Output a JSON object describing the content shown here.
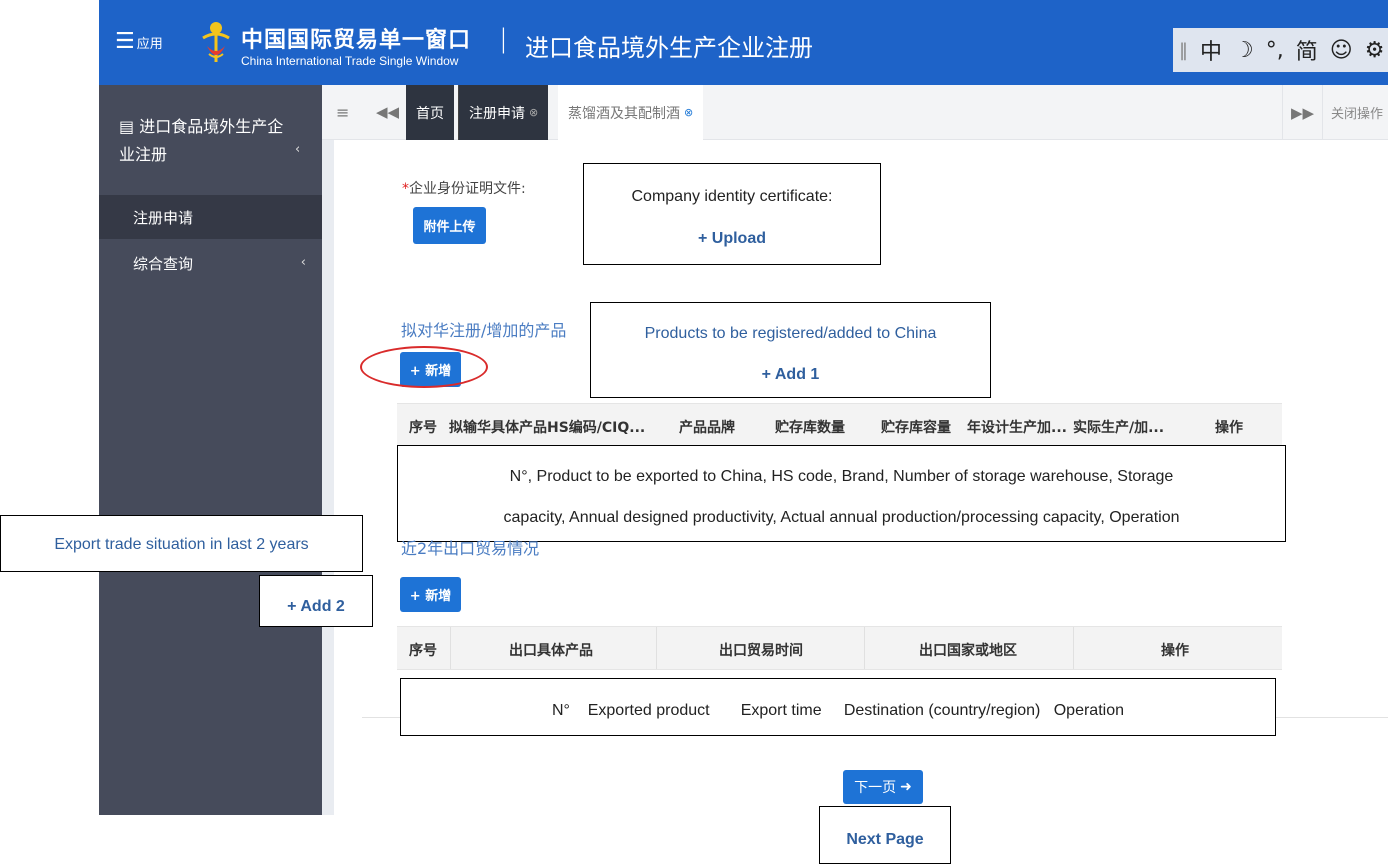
{
  "header": {
    "app_label": "应用",
    "brand_cn": "中国国际贸易单一窗口",
    "brand_en": "China International Trade Single Window",
    "separator": "|",
    "system_title": "进口食品境外生产企业注册",
    "ime": {
      "grip": "‖",
      "lang": "中",
      "moon": "☽",
      "punct": "°,",
      "simplified": "简",
      "emoji": "☺",
      "settings": "⚙"
    }
  },
  "sidebar": {
    "title": "进口食品境外生产企业注册",
    "items": [
      {
        "label": "注册申请",
        "active": true
      },
      {
        "label": "综合查询",
        "active": false
      }
    ]
  },
  "tabs": {
    "items": [
      {
        "label": "首页"
      },
      {
        "label": "注册申请"
      },
      {
        "label": "蒸馏酒及其配制酒"
      }
    ],
    "close_ops": "关闭操作"
  },
  "form": {
    "identity_label": "企业身份证明文件:",
    "upload_button": "附件上传",
    "products_title": "拟对华注册/增加的产品",
    "add_button_1": "+ 新增",
    "product_columns": [
      "序号",
      "拟输华具体产品HS编码/CIQ...",
      "产品品牌",
      "贮存库数量",
      "贮存库容量",
      "年设计生产加...",
      "实际生产/加...",
      "操作"
    ],
    "export_title": "近2年出口贸易情况",
    "add_button_2": "+ 新增",
    "export_columns": [
      "序号",
      "出口具体产品",
      "出口贸易时间",
      "出口国家或地区",
      "操作"
    ],
    "next_button": "下一页"
  },
  "annotations": {
    "identity_line1": "Company identity certificate:",
    "identity_line2": "+ Upload",
    "products_line1": "Products to be registered/added to China",
    "products_line2": "+ Add 1",
    "columns_line1": "N°, Product to be exported to China, HS code, Brand, Number of storage warehouse, Storage",
    "columns_line2": "capacity, Annual designed productivity, Actual annual production/processing capacity, Operation",
    "export_situation": "Export trade situation in last 2 years",
    "add2": "+ Add 2",
    "export_columns": "N°    Exported product       Export time     Destination (country/region)   Operation",
    "next_page": "Next Page"
  },
  "colors": {
    "header_bg": "#1e63c8",
    "sidebar_bg": "#464b5b",
    "button_blue": "#1e73d6",
    "highlight_red": "#d92b2b"
  }
}
